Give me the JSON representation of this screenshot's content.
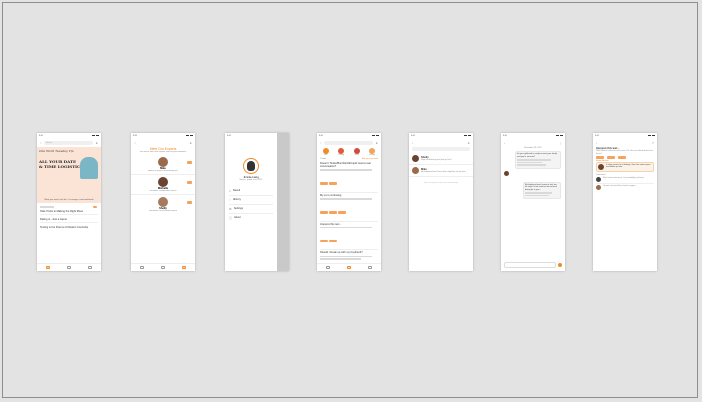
{
  "feed": {
    "search_placeholder": "Search",
    "hero_tag": "One Word Tuesday Tip",
    "hero_title_line1": "ALL YOUR DATE",
    "hero_title_line2": "& TIME LOGISTICS",
    "hero_caption": "Work your week, lock the * to arrange a cool work/week",
    "items": [
      "Take Tricks to Making the Right Move",
      "Dating is...Just a Game",
      "Texting is the Poems of Modern Courtship"
    ]
  },
  "experts": {
    "title": "Meet Our Experts",
    "subtitle": "Get advice from love experts and ask your questions",
    "list": [
      {
        "name": "Mike",
        "desc": "Advice & general relationship tips"
      },
      {
        "name": "Michelle",
        "desc": "Flirtatious, independent advice"
      },
      {
        "name": "Shelly",
        "desc": "Flirtatious, fun and warm advice"
      }
    ]
  },
  "menu": {
    "user_name": "Jimmie Liang",
    "user_sub": "Novice, joined since 2021",
    "items": [
      "Saved",
      "History",
      "Settings",
      "About"
    ]
  },
  "forum": {
    "categories": [
      "Hot",
      "Dating",
      "Flirty",
      "Dating"
    ],
    "header_left": "Trends",
    "header_right": "Ask your question",
    "posts": [
      "Doesn't Tinder/Bumble/OkCupid need a real conversation?",
      "My ex is confusing",
      "Interpret this text...",
      "Should I break up with my boyfriend?"
    ]
  },
  "inbox": {
    "title": "Inbox",
    "threads": [
      {
        "name": "Shelly",
        "preview": "Stop overthinking and just go for it!"
      },
      {
        "name": "Mike",
        "preview": "My boyfriend and I have been together for the last..."
      }
    ],
    "footer": "Here to help you with your relationship"
  },
  "chat": {
    "date": "November 28, 2021",
    "messages": [
      "So your girlfriend is ready to meet your family and you're nervous?",
      "My boyfriend won't move in with me, he says it's too soon but we've been dating for a year..."
    ]
  },
  "question": {
    "title": "Interpret this text...",
    "body": "What does it mean when he texts 'Ok' after we talked about it for hours?",
    "tags": [
      "Dating",
      "Texting",
      "Help"
    ],
    "answer_heading": "Expert Answer",
    "answer": "It often means he's thinking. Give him some space and follow up later.",
    "comments_heading": "Comments",
    "comments": [
      "Don't stress too much, he's probably just busy.",
      "I'd wait a bit and then check in again."
    ]
  }
}
